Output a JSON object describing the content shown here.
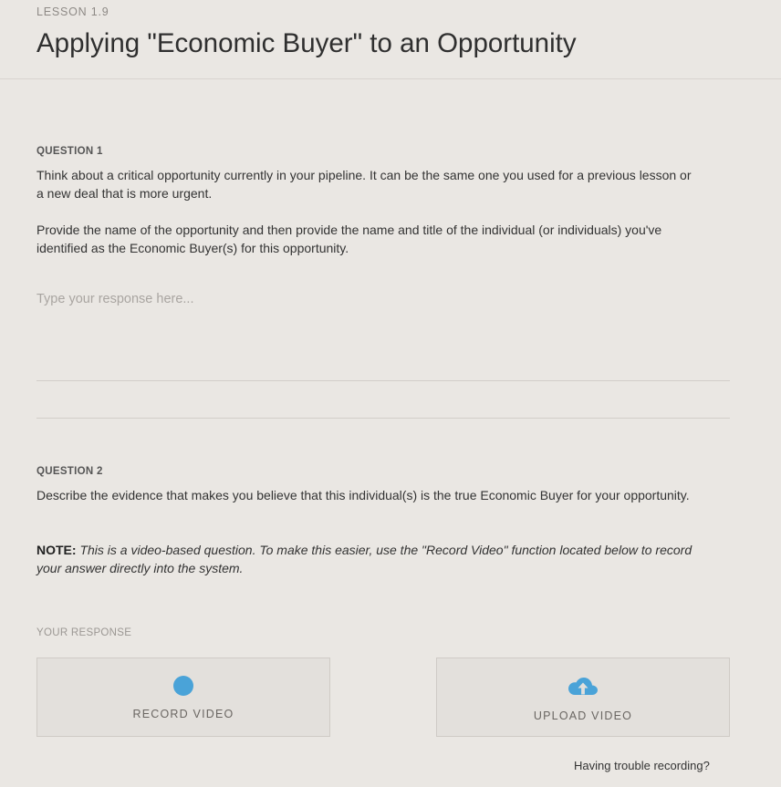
{
  "lesson": {
    "label": "LESSON 1.9",
    "title": "Applying \"Economic Buyer\" to an Opportunity"
  },
  "question1": {
    "label": "QUESTION 1",
    "paragraph1": "Think about a critical opportunity currently in your pipeline. It can be the same one you used for a previous lesson or a new deal that is more urgent.",
    "paragraph2": "Provide the name of the opportunity and then provide the name and title of the individual (or individuals) you've identified as the Economic Buyer(s) for this opportunity.",
    "response_value": "",
    "response_placeholder": "Type your response here..."
  },
  "question2": {
    "label": "QUESTION 2",
    "paragraph1": "Describe the evidence that makes you believe that this individual(s) is the true Economic Buyer for your opportunity.",
    "note_label": "NOTE:",
    "note_text": "This is a video-based question. To make this easier, use the \"Record Video\" function located below to record your answer directly into the system."
  },
  "response_section": {
    "label": "YOUR RESPONSE",
    "record_label": "RECORD VIDEO",
    "upload_label": "UPLOAD VIDEO",
    "trouble_link": "Having trouble recording?"
  },
  "icons": {
    "record": "record-dot-icon",
    "upload": "cloud-upload-icon"
  },
  "colors": {
    "background": "#eae7e3",
    "accent": "#4aa3d8",
    "button_bg": "#e3e0dc"
  }
}
